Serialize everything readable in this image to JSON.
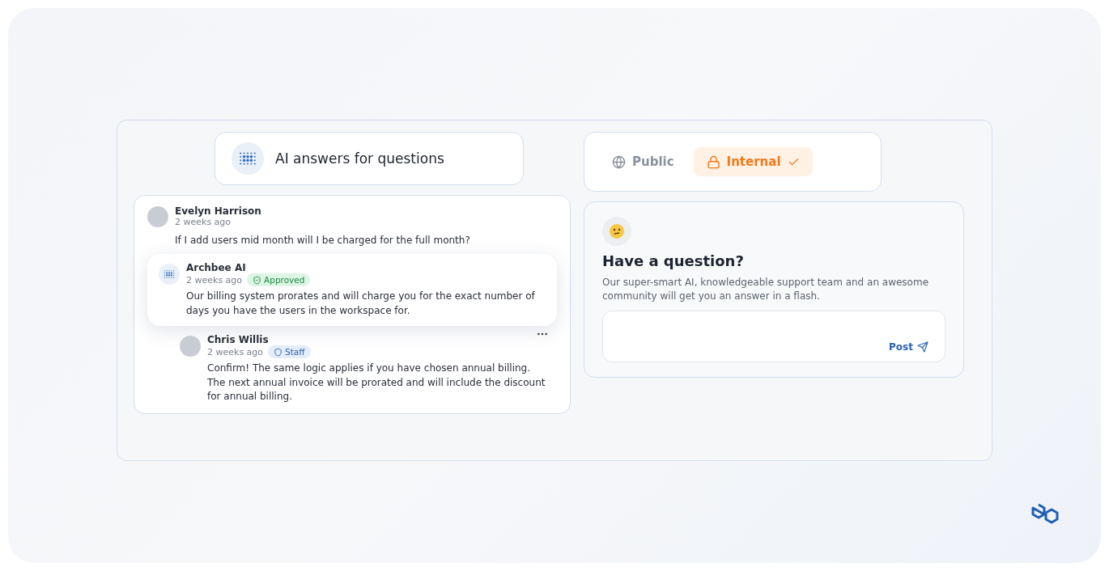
{
  "title_card": {
    "title": "AI answers for questions"
  },
  "visibility": {
    "options": [
      {
        "kind": "globe",
        "label": "Public",
        "selected": false
      },
      {
        "kind": "lock",
        "label": "Internal",
        "selected": true
      }
    ]
  },
  "thread": {
    "question": {
      "author": "Evelyn Harrison",
      "time": "2 weeks ago",
      "text": "If I add users mid month will I be charged for the full month?"
    },
    "replies": [
      {
        "kind": "ai",
        "author": "Archbee AI",
        "time": "2 weeks ago",
        "badge": "Approved",
        "text": "Our billing system prorates and will charge you for the exact number of days you have the users in the workspace for."
      },
      {
        "kind": "staff",
        "author": "Chris Willis",
        "time": "2 weeks ago",
        "badge": "Staff",
        "text": "Confirm! The same logic applies if you have chosen annual billing. The next annual invoice will be prorated and will include the discount for annual billing."
      }
    ]
  },
  "ask": {
    "title": "Have a question?",
    "description": "Our super-smart AI, knowledgeable support team and an awesome community will get you an answer in a flash.",
    "post_label": "Post"
  }
}
